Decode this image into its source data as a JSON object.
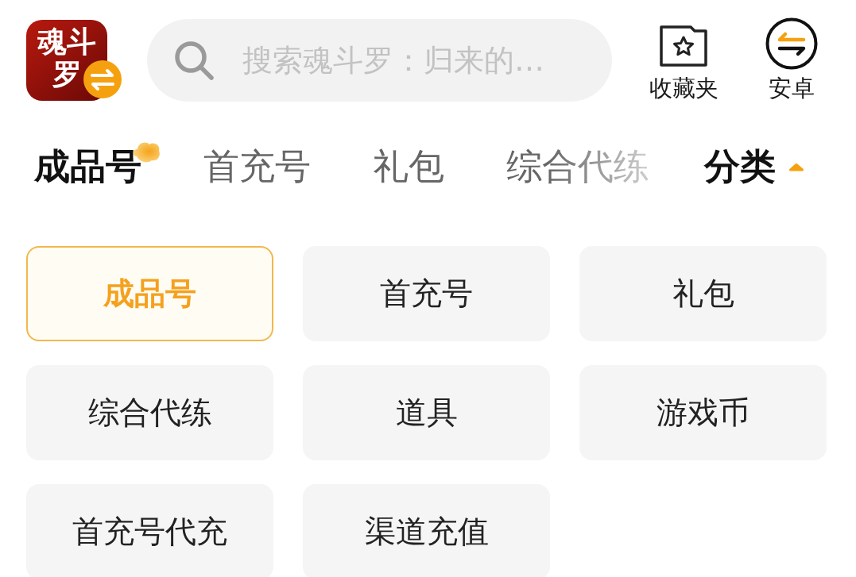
{
  "app_logo": {
    "label": "魂斗罗"
  },
  "search": {
    "placeholder": "搜索魂斗罗：归来的…"
  },
  "header_actions": [
    {
      "label": "收藏夹",
      "kind": "favorites"
    },
    {
      "label": "安卓",
      "kind": "platform"
    }
  ],
  "tabs": [
    {
      "label": "成品号",
      "selected": true
    },
    {
      "label": "首充号",
      "selected": false
    },
    {
      "label": "礼包",
      "selected": false
    },
    {
      "label": "综合代练",
      "selected": false
    }
  ],
  "category_toggle": {
    "label": "分类",
    "expanded": true
  },
  "categories": [
    {
      "label": "成品号",
      "selected": true
    },
    {
      "label": "首充号",
      "selected": false
    },
    {
      "label": "礼包",
      "selected": false
    },
    {
      "label": "综合代练",
      "selected": false
    },
    {
      "label": "道具",
      "selected": false
    },
    {
      "label": "游戏币",
      "selected": false
    },
    {
      "label": "首充号代充",
      "selected": false
    },
    {
      "label": "渠道充值",
      "selected": false
    }
  ]
}
